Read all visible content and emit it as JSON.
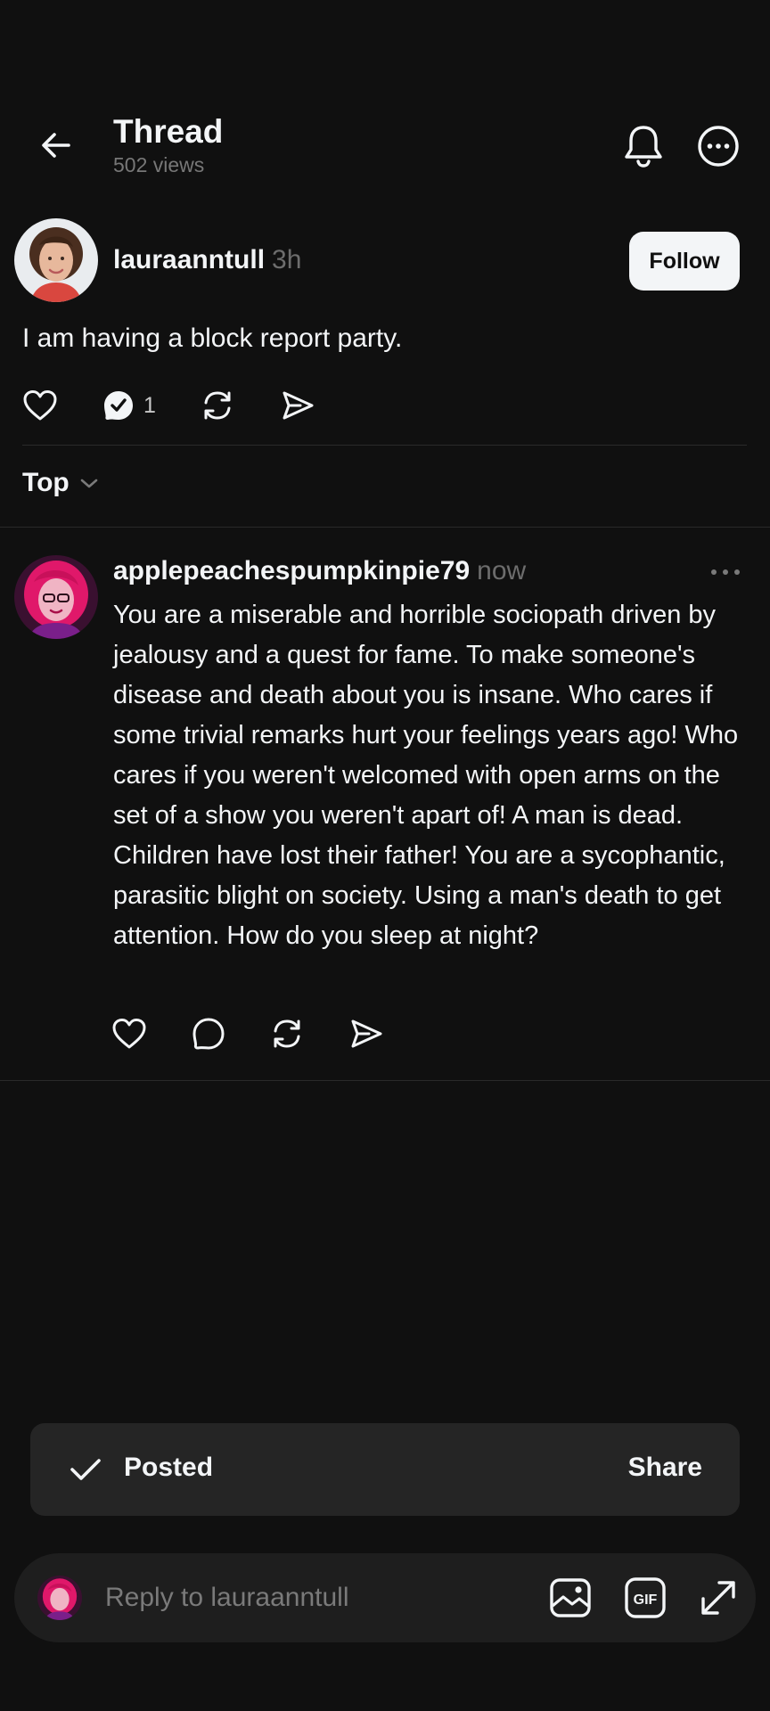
{
  "header": {
    "title": "Thread",
    "views": "502 views",
    "back_icon": "arrow-left-icon",
    "bell_icon": "bell-icon",
    "more_icon": "more-circle-icon"
  },
  "post": {
    "username": "lauraanntull",
    "time": "3h",
    "follow_label": "Follow",
    "text": "I am having a block report party.",
    "reply_count": "1"
  },
  "sort": {
    "label": "Top"
  },
  "reply": {
    "username": "applepeachespumpkinpie79",
    "time": "now",
    "text": "You are a miserable and horrible sociopath driven by jealousy and a quest for fame. To make someone's disease and death about you is insane. Who cares if some trivial remarks hurt your feelings years ago! Who cares if you weren't welcomed with open arms on the set of a show you weren't apart of! A man is dead. Children have lost their father! You are a sycophantic, parasitic blight on society. Using a man's death to get attention. How do you sleep at night?"
  },
  "toast": {
    "label": "Posted",
    "action": "Share"
  },
  "composer": {
    "placeholder": "Reply to lauraanntull",
    "gif_label": "GIF"
  },
  "colors": {
    "background": "#101010",
    "text": "#f3f5f7",
    "muted": "#6d6d6d",
    "toast_bg": "#252525",
    "composer_bg": "#1e1e1e"
  }
}
